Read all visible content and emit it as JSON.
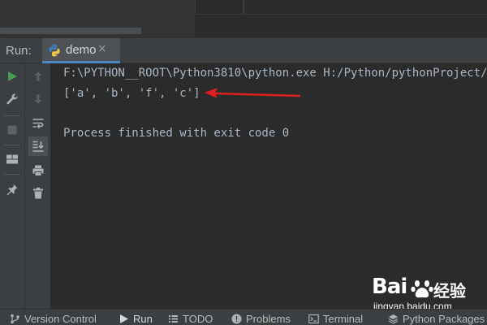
{
  "run_window": {
    "label": "Run:",
    "tab": {
      "title": "demo",
      "close": "×",
      "icon": "python-icon"
    }
  },
  "toolbar": {
    "primary": [
      "rerun-icon",
      "settings-wrench-icon",
      "stop-icon",
      "layout-icon",
      "pin-icon"
    ],
    "secondary": [
      "up-arrow-icon",
      "down-arrow-icon",
      "soft-wrap-icon",
      "scroll-to-end-icon",
      "print-icon",
      "trash-icon"
    ]
  },
  "console": {
    "lines": [
      "F:\\PYTHON__ROOT\\Python3810\\python.exe H:/Python/pythonProject/",
      "['a', 'b', 'f', 'c']",
      "",
      "Process finished with exit code 0"
    ]
  },
  "annotation": {
    "color": "#e02020"
  },
  "watermark": {
    "logo": "Bai",
    "cn": "经验",
    "url": "jingyan.baidu.com"
  },
  "bottom_bar": {
    "items": [
      {
        "label": "Version Control",
        "icon": "branch-icon"
      },
      {
        "label": "Run",
        "icon": "play-icon"
      },
      {
        "label": "TODO",
        "icon": "list-icon"
      },
      {
        "label": "Problems",
        "icon": "warning-icon"
      },
      {
        "label": "Terminal",
        "icon": "terminal-icon"
      },
      {
        "label": "Python Packages",
        "icon": "layers-icon"
      }
    ]
  },
  "colors": {
    "play": "#499c54",
    "console_text": "#a9b7c6",
    "tab_underline": "#4a88c7"
  }
}
